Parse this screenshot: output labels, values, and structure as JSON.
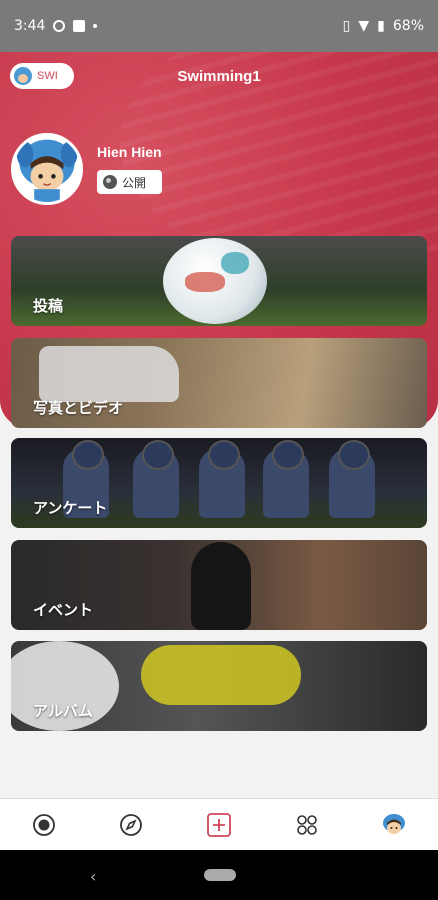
{
  "status_bar": {
    "time": "3:44",
    "battery": "68%"
  },
  "header": {
    "team_pill_label": "SWI",
    "title": "Swimming1"
  },
  "profile": {
    "name": "Hien Hien",
    "visibility": "公開"
  },
  "categories": [
    {
      "label": "投稿"
    },
    {
      "label": "写真とビデオ"
    },
    {
      "label": "アンケート"
    },
    {
      "label": "イベント"
    },
    {
      "label": "アルバム"
    }
  ],
  "bottom_nav": {
    "accent_color": "#d0465a",
    "items": [
      "home-icon",
      "compass-icon",
      "add-icon",
      "apps-icon",
      "profile-avatar"
    ]
  },
  "colors": {
    "header_red": "#c7384c",
    "status_bar": "#7a7a7a"
  }
}
